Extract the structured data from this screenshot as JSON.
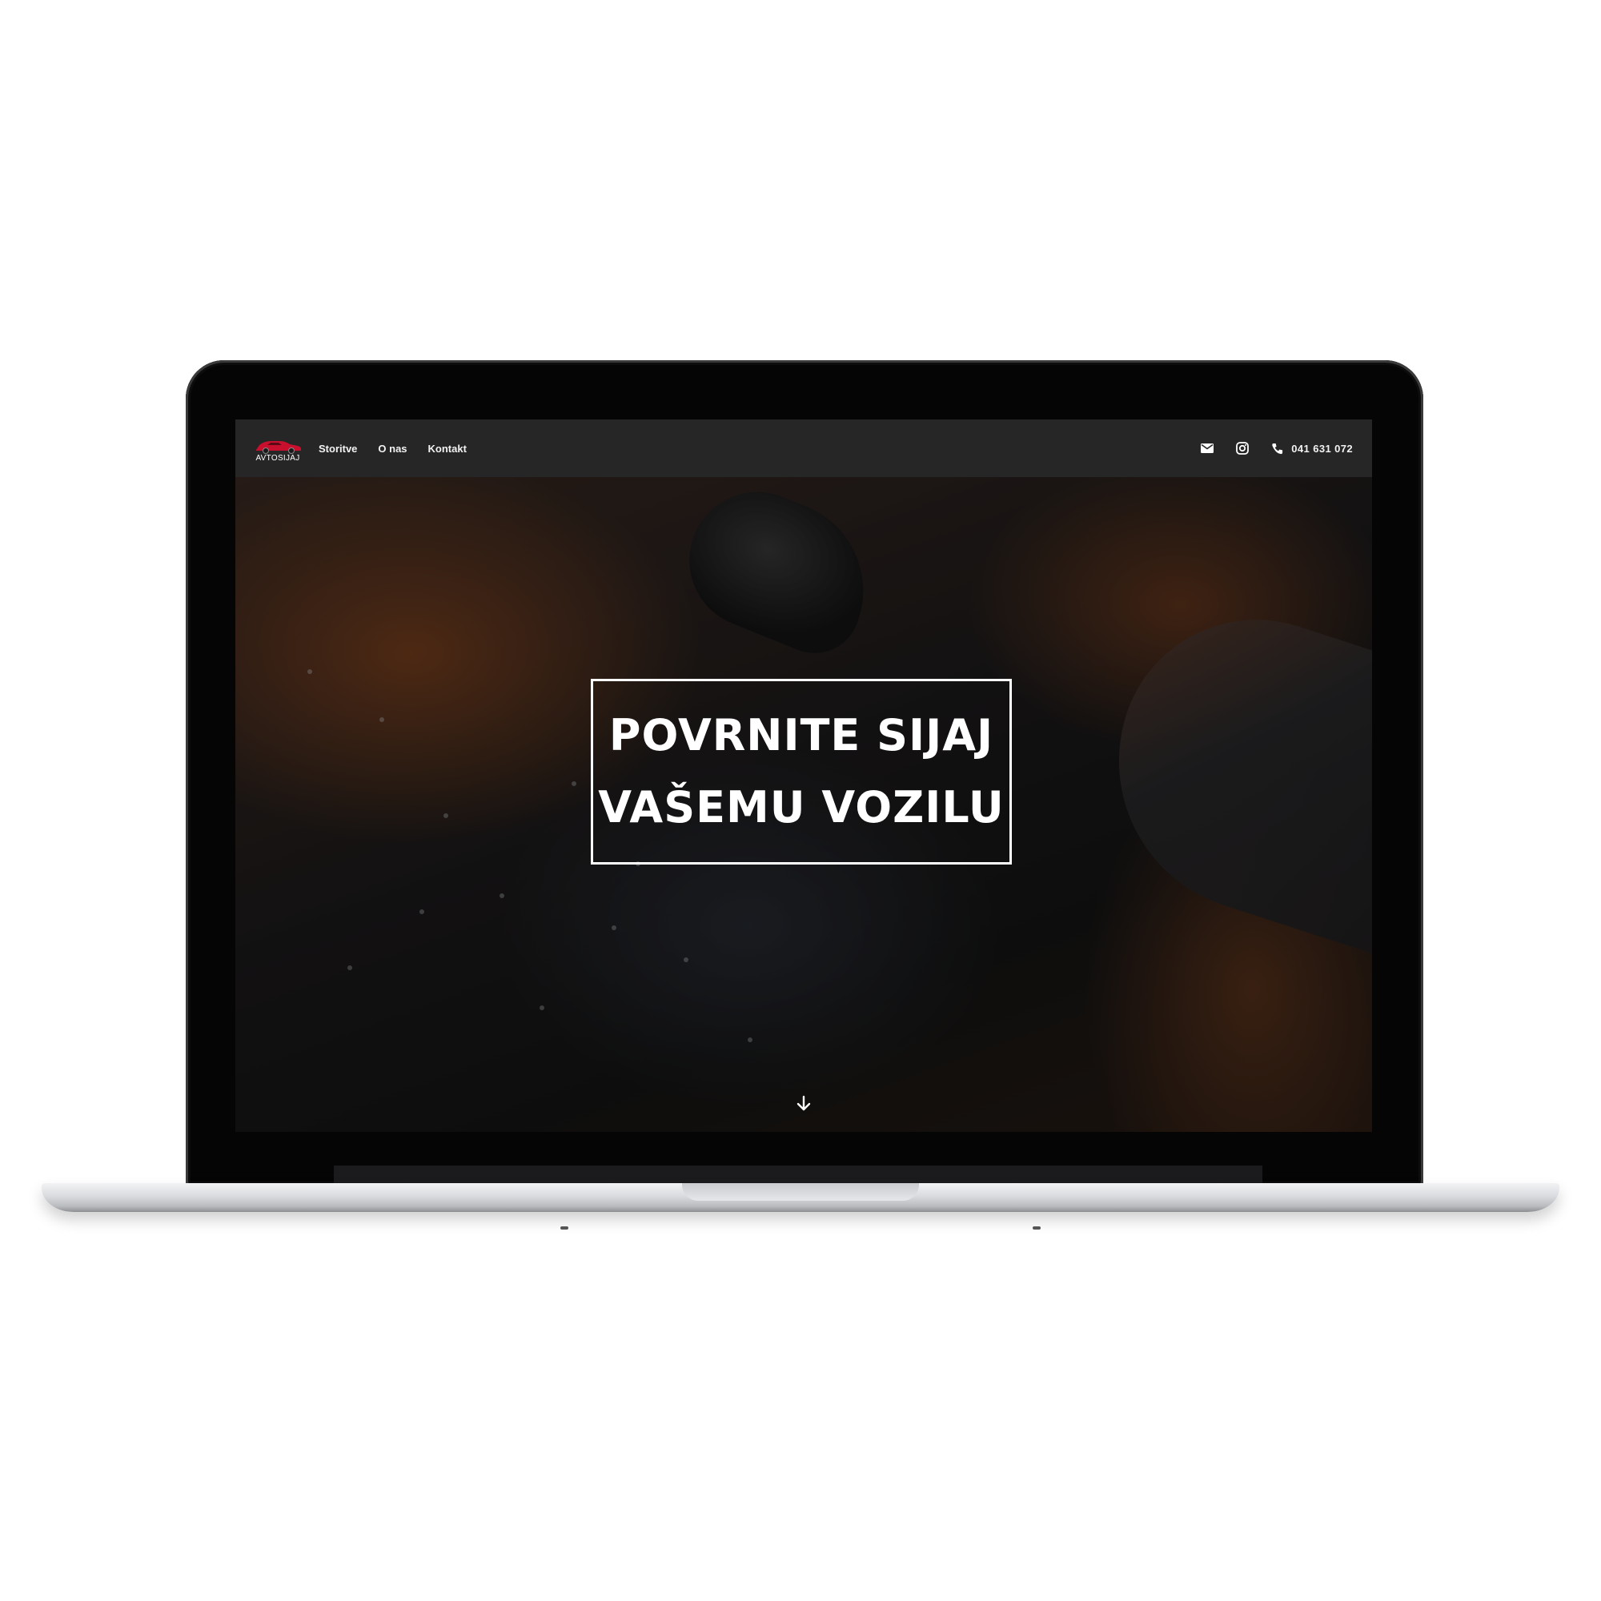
{
  "site": {
    "logo": {
      "text": "AVTOSIJAJ",
      "icon": "red-car-logo",
      "color": "#c8102e"
    },
    "nav": {
      "items": [
        {
          "label": "Storitve"
        },
        {
          "label": "O nas"
        },
        {
          "label": "Kontakt"
        }
      ]
    },
    "contacts": {
      "email_icon": "envelope-icon",
      "instagram_icon": "instagram-icon",
      "phone_icon": "phone-icon",
      "phone": "041 631 072"
    },
    "hero": {
      "headline_line1": "POVRNITE SIJAJ",
      "headline_line2": "VAŠEMU VOZILU",
      "scroll_icon": "arrow-down-icon"
    }
  }
}
